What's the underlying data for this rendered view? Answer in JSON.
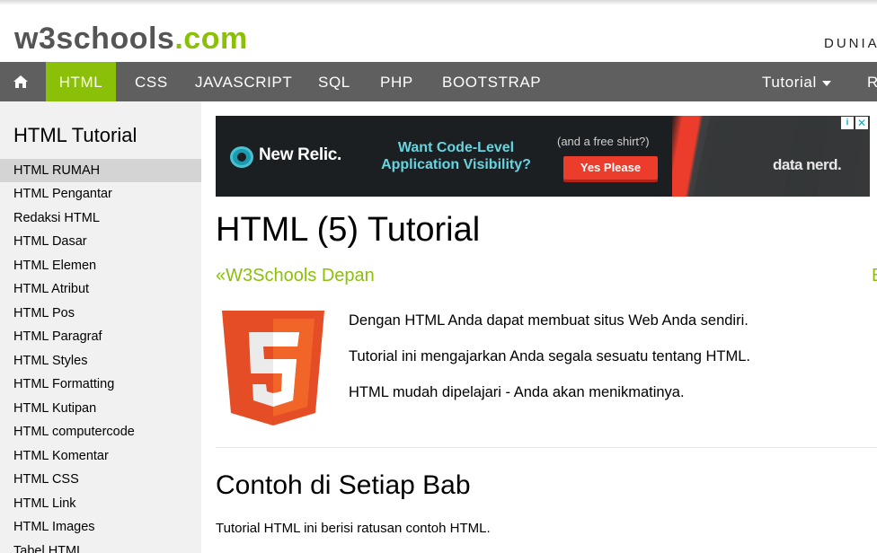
{
  "header": {
    "logo_main": "w3schools",
    "logo_suffix": ".com",
    "tagline": "DUNIA"
  },
  "navbar": {
    "home_icon": "home-icon",
    "items": [
      "HTML",
      "CSS",
      "JAVASCRIPT",
      "SQL",
      "PHP",
      "BOOTSTRAP"
    ],
    "tutorial_label": "Tutorial",
    "cutoff_label": "R"
  },
  "sidebar": {
    "title": "HTML Tutorial",
    "items": [
      "HTML RUMAH",
      "HTML Pengantar",
      "Redaksi HTML",
      "HTML Dasar",
      "HTML Elemen",
      "HTML Atribut",
      "HTML Pos",
      "HTML Paragraf",
      "HTML Styles",
      "HTML Formatting",
      "HTML Kutipan",
      "HTML computercode",
      "HTML Komentar",
      "HTML CSS",
      "HTML Link",
      "HTML Images",
      "Tabel HTML"
    ],
    "active_index": 0
  },
  "ad": {
    "brand": "New Relic.",
    "headline": "Want Code-Level Application Visibility?",
    "subtext": "(and a free shirt?)",
    "cta": "Yes Please",
    "shirt_text": "data nerd."
  },
  "main": {
    "title": "HTML (5) Tutorial",
    "prev_link": "«W3Schools Depan",
    "next_link": "B",
    "intro": [
      "Dengan HTML Anda dapat membuat situs Web Anda sendiri.",
      "Tutorial ini mengajarkan Anda segala sesuatu tentang HTML.",
      "HTML mudah dipelajari - Anda akan menikmatinya."
    ],
    "section_title": "Contoh di Setiap Bab",
    "section_text": "Tutorial HTML ini berisi ratusan contoh HTML."
  },
  "colors": {
    "brand_green": "#8ac007",
    "navbar": "#5f5f5f",
    "sidebar": "#f1f1f1",
    "html5_orange": "#e44d26"
  }
}
